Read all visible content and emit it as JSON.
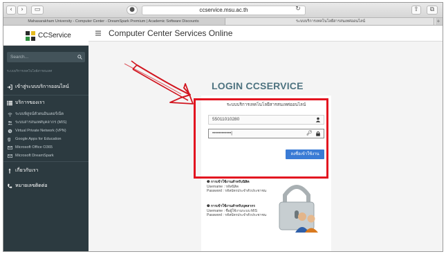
{
  "browser": {
    "url": "ccservice.msu.ac.th",
    "tabs": [
      {
        "label": "Mahasarakham University - Computer Center - DreamSpark Premium | Academic Software Discounts"
      },
      {
        "label": "ระบบบริการเทคโนโลยีสารสนเทศออนไลน์"
      }
    ]
  },
  "sidebar": {
    "logo_text": "CCService",
    "search_placeholder": "Search...",
    "caption": "ระบบบริการเทคโนโลยีสารสนเทศ",
    "login_item": "เข้าสู่ระบบบริการออนไลน์",
    "services_header": "บริการของเรา",
    "services": [
      "ระบบพิสูจน์ตัวตนอินเตอร์เน็ต",
      "ระบบสารสนเทศบุคลากร (MIS)",
      "Virtual Private Network (VPN)",
      "Google Apps for Education",
      "Microsoft Office O365",
      "Microsoft DreamSpark"
    ],
    "about_item": "เกี่ยวกับเรา",
    "contact_item": "หมายเลขติดต่อ"
  },
  "header": {
    "title": "Computer Center Services Online"
  },
  "login": {
    "title": "LOGIN CCSERVICE",
    "subtitle": "ระบบบริการเทคโนโลยีสารสนเทศออนไลน์",
    "username_value": "55011010280",
    "password_value": "••••••••••••|",
    "button_label": "ลงชื่อเข้าใช้งาน"
  },
  "info": {
    "student_heading": "การเข้าใช้งานสำหรับนิสิต",
    "student_username": "Username : รหัสนิสิต",
    "student_password": "Password : รหัสบัตรประจำตัวประชาชน",
    "staff_heading": "การเข้าใช้งานสำหรับบุคลากร",
    "staff_username": "Username : ชื่อผู้ใช้งานระบบ MIS",
    "staff_password": "Password : รหัสบัตรประจำตัวประชาชน"
  },
  "colors": {
    "sidebar_bg": "#2c3a40",
    "highlight_red": "#e3131f",
    "button_blue": "#3a7bd5",
    "title_teal": "#4e7380"
  }
}
